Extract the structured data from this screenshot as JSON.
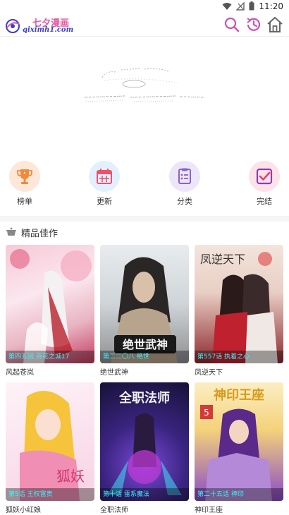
{
  "status_bar": {
    "time": "11:20"
  },
  "header": {
    "logo_text": "七夕漫画",
    "logo_url": "qiximh1.com"
  },
  "icons": {
    "search": "search-icon",
    "history": "history-icon",
    "home": "home-icon"
  },
  "categories": [
    {
      "label": "榜单",
      "icon": "trophy-icon",
      "bg": "#fde7d8",
      "color": "#f08a3c"
    },
    {
      "label": "更新",
      "icon": "calendar-icon",
      "bg": "#e2f0fd",
      "color": "#f2506a"
    },
    {
      "label": "分类",
      "icon": "list-icon",
      "bg": "#ede6f8",
      "color": "#8a62c9"
    },
    {
      "label": "完结",
      "icon": "checkbox-icon",
      "bg": "#fde2ea",
      "color": "#8a3fb0"
    }
  ],
  "section": {
    "title": "精品佳作"
  },
  "comics": [
    {
      "title": "风起苍岚",
      "chapter": "第四五回 百花之城17",
      "c1": "#f7c9d6",
      "c2": "#c43a5e"
    },
    {
      "title": "绝世武神",
      "chapter": "第二二〇八 绝世",
      "c1": "#dfe4e8",
      "c2": "#3b3a3a"
    },
    {
      "title": "凤逆天下",
      "chapter": "第557话 执着之心",
      "c1": "#f0d8d0",
      "c2": "#b8202a"
    },
    {
      "title": "狐妖小红娘",
      "chapter": "第5话 王权富贵",
      "c1": "#fbe6f0",
      "c2": "#f0b13a"
    },
    {
      "title": "全职法师",
      "chapter": "第十话 雷系魔法",
      "c1": "#2b1f5a",
      "c2": "#8a36c9"
    },
    {
      "title": "神印王座",
      "chapter": "第二十五话 神印",
      "c1": "#f6e2a8",
      "c2": "#6a3aa8"
    }
  ]
}
